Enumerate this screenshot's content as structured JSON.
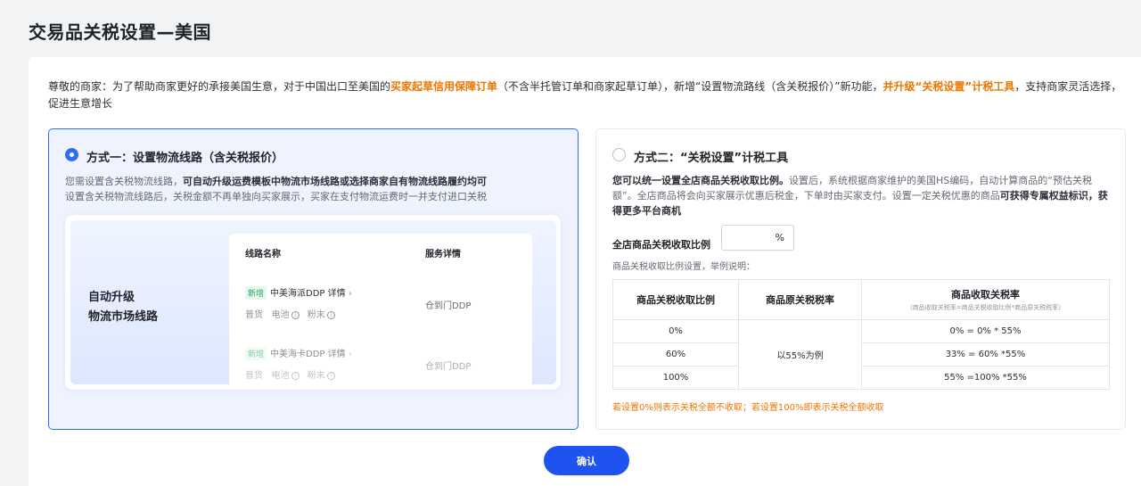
{
  "page": {
    "title": "交易品关税设置—美国"
  },
  "notice": {
    "part1": "尊敬的商家：为了帮助商家更好的承接美国生意，对于中国出口至美国的",
    "highlight1": "买家起草信用保障订单",
    "part2": "（不含半托管订单和商家起草订单），新增“设置物流路线（含关税报价）”新功能，",
    "highlight2": "并升级“关税设置”计税工具",
    "part3": "，支持商家灵活选择，促进生意增长"
  },
  "option1": {
    "title": "方式一：设置物流线路（含关税报价）",
    "selected": true,
    "desc_plain1": "您需设置含关税物流线路，",
    "desc_bold": "可自动升级运费模板中物流市场线路或选择商家自有物流线路履约均可",
    "desc_plain2": "设置含关税物流线路后，关税金额不再单独向买家展示，买家在支付物流运费时一并支付进口关税",
    "preview": {
      "label_line1": "自动升级",
      "label_line2": "物流市场线路",
      "col_route": "线路名称",
      "col_service": "服务详情",
      "routes": [
        {
          "tag": "新增",
          "name": "中美海派DDP 详情",
          "arrow": "›",
          "attrs": [
            "普货",
            "电池",
            "粉末"
          ],
          "info": "i",
          "service": "仓到门DDP"
        },
        {
          "tag": "新增",
          "name": "中美海卡DDP 详情",
          "arrow": "›",
          "attrs": [
            "普货",
            "电池",
            "粉末"
          ],
          "info": "i",
          "service": "仓到门DDP"
        }
      ]
    }
  },
  "option2": {
    "title": "方式二：“关税设置”计税工具",
    "selected": false,
    "desc_bold1": "您可以统一设置全店商品关税收取比例。",
    "desc_plain1": "设置后，系统根据商家维护的美国HS编码，自动计算商品的“预估关税额”。全店商品将会向买家展示优惠后税金，下单时由买家支付。设置一定关税优惠的商品",
    "desc_bold2": "可获得专属权益标识，获得更多平台商机",
    "rate_label": "全店商品关税收取比例",
    "rate_value": "",
    "rate_unit": "%",
    "example_label": "商品关税收取比例设置，举例说明：",
    "table": {
      "headers": [
        "商品关税收取比例",
        "商品原关税税率",
        "商品收取关税率"
      ],
      "header_sub": "（商品收取关税率=商品关税收取比例*商品原关税税率）",
      "rows": [
        {
          "ratio": "0%",
          "result": "0% = 0% * 55%"
        },
        {
          "ratio": "60%",
          "result": "33% = 60% *55%"
        },
        {
          "ratio": "100%",
          "result": "55% =100% *55%"
        }
      ],
      "merged_original": "以55%为例"
    },
    "warning": "若设置0%则表示关税全额不收取；若设置100%即表示关税全额收取"
  },
  "actions": {
    "confirm_label": "确认"
  },
  "colors": {
    "primary": "#1f53f0",
    "accent": "#f07400",
    "selected_bg": "#eef3ff"
  }
}
